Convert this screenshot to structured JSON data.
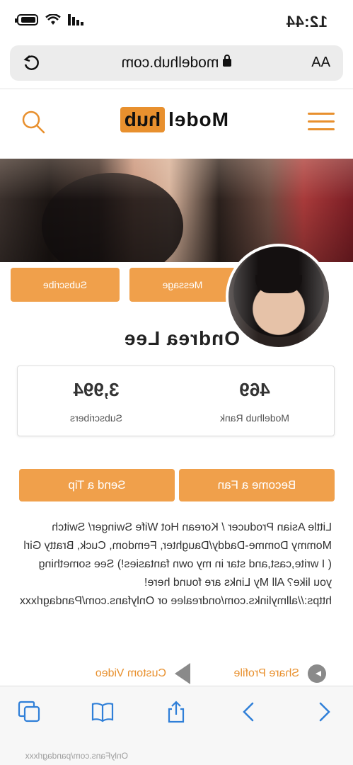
{
  "status_bar": {
    "time": "12:44"
  },
  "url_bar": {
    "text_size_label": "AA",
    "url": "modelhub.com"
  },
  "site_header": {
    "logo_model": "Model",
    "logo_hub": "hub"
  },
  "profile": {
    "name": "Ondrea Lee",
    "message_label": "Message",
    "subscribe_label": "Subscribe",
    "stats": [
      {
        "value": "469",
        "label": "Modelhub Rank"
      },
      {
        "value": "3,994",
        "label": "Subscribers"
      }
    ],
    "become_fan_label": "Become a Fan",
    "send_tip_label": "Send a Tip",
    "bio": "Little Asian Producer / Korean Hot Wife Swinger/ Switch Mommy Domme-Daddy/Daughter, Femdom, Cuck, Bratty Girl ( I write,cast,and star in my own fantasies!) See something you like? All My Links are found here! https://allmylinks.com/ondrealee or Onlyfans.com/Pandagrlxxx",
    "share_profile_label": "Share Profile",
    "custom_video_label": "Custom Video"
  },
  "toolbar": {
    "icons": [
      "back-icon",
      "forward-icon",
      "share-icon",
      "bookmarks-icon",
      "tabs-icon"
    ]
  },
  "watermark": "OnlyFans.com/pandagrlxxx",
  "colors": {
    "accent": "#e8902e",
    "button": "#f0a04b",
    "toolbar_icon": "#2f7fd8"
  }
}
